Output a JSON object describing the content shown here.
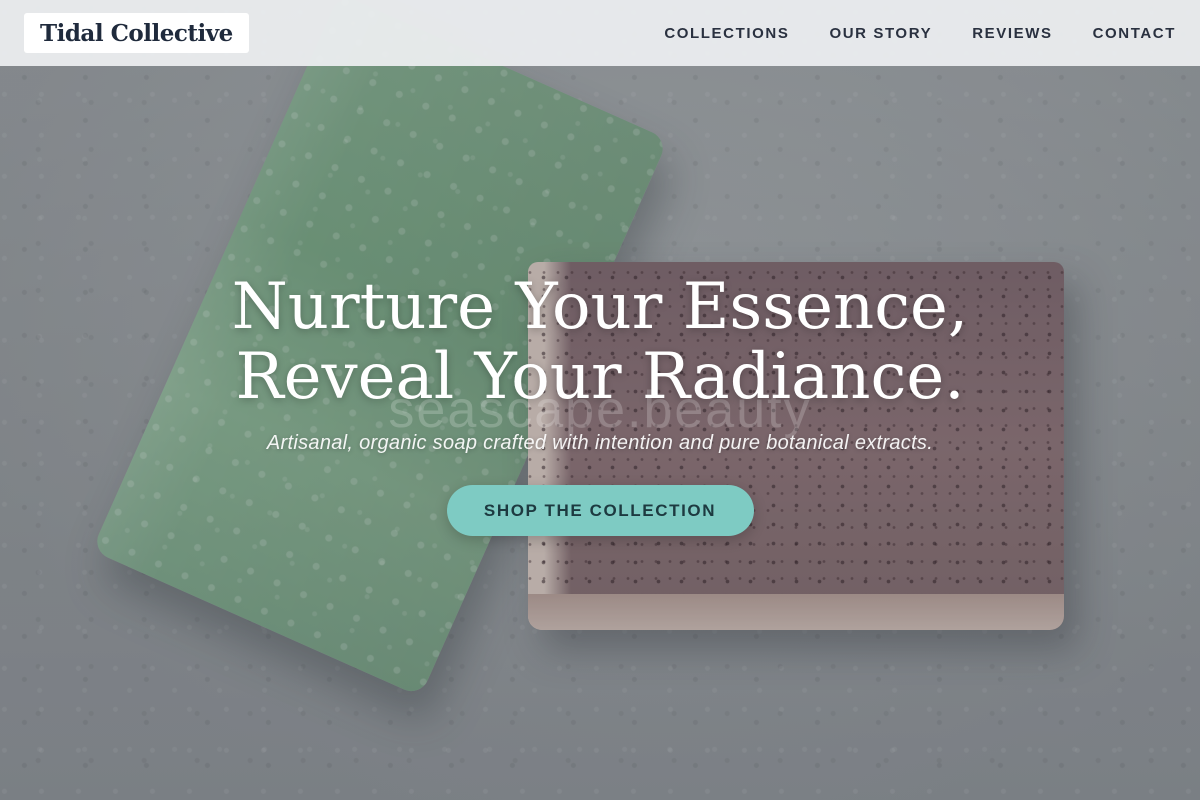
{
  "brand": {
    "name": "Tidal Collective"
  },
  "nav": {
    "items": [
      {
        "label": "COLLECTIONS"
      },
      {
        "label": "OUR STORY"
      },
      {
        "label": "REVIEWS"
      },
      {
        "label": "CONTACT"
      }
    ]
  },
  "hero": {
    "headline_line1": "Nurture Your Essence,",
    "headline_line2": "Reveal Your Radiance.",
    "subheadline": "Artisanal, organic soap crafted with intention and pure botanical extracts.",
    "cta_label": "SHOP THE COLLECTION",
    "watermark": "seascape.beauty"
  },
  "colors": {
    "accent": "#7ecbc3",
    "header_bg": "#eceef0",
    "text_dark": "#1f2a3c"
  }
}
